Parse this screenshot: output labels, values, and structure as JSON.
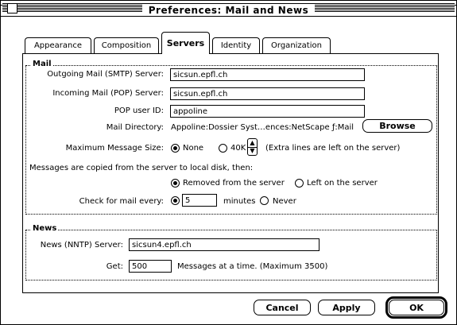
{
  "window": {
    "title": "Preferences: Mail and News"
  },
  "tabs": [
    {
      "label": "Appearance"
    },
    {
      "label": "Composition"
    },
    {
      "label": "Servers"
    },
    {
      "label": "Identity"
    },
    {
      "label": "Organization"
    }
  ],
  "mail": {
    "group_label": "Mail",
    "smtp_label": "Outgoing Mail (SMTP) Server:",
    "smtp_value": "sicsun.epfl.ch",
    "pop_label": "Incoming Mail (POP) Server:",
    "pop_value": "sicsun.epfl.ch",
    "userid_label": "POP user ID:",
    "userid_value": "appoline",
    "dir_label": "Mail Directory:",
    "dir_value": "Appoline:Dossier Syst…ences:NetScape ƒ:Mail",
    "browse_label": "Browse",
    "maxsize_label": "Maximum Message Size:",
    "maxsize_none": "None",
    "maxsize_value": "40K",
    "maxsize_note": "(Extra lines are left on the server)",
    "copy_text": "Messages are copied from the server to local disk, then:",
    "removed_label": "Removed from the server",
    "left_label": "Left on the server",
    "check_label": "Check for mail every:",
    "check_value": "5",
    "minutes_label": "minutes",
    "never_label": "Never"
  },
  "news": {
    "group_label": "News",
    "nntp_label": "News (NNTP) Server:",
    "nntp_value": "sicsun4.epfl.ch",
    "get_label": "Get:",
    "get_value": "500",
    "get_note": "Messages at a time. (Maximum 3500)"
  },
  "buttons": {
    "cancel": "Cancel",
    "apply": "Apply",
    "ok": "OK"
  }
}
